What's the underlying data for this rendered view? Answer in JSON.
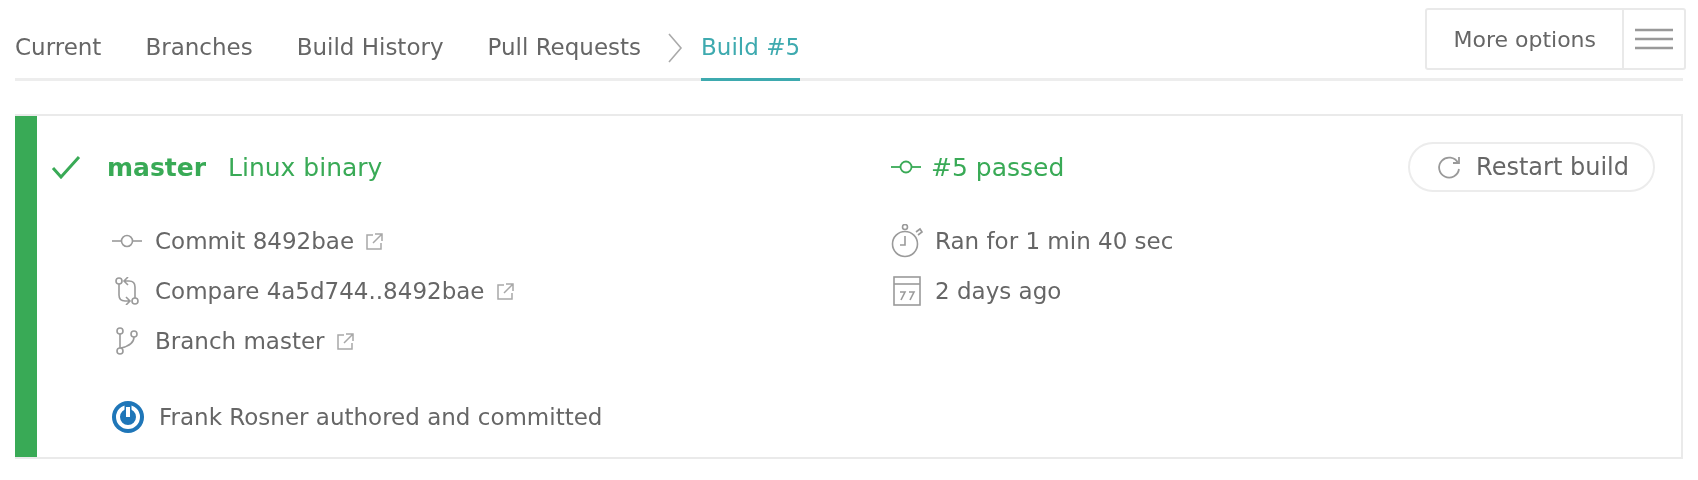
{
  "tabs": [
    {
      "label": "Current",
      "selected": false
    },
    {
      "label": "Branches",
      "selected": false
    },
    {
      "label": "Build History",
      "selected": false
    },
    {
      "label": "Pull Requests",
      "selected": false
    },
    {
      "label": "Build #5",
      "selected": true
    }
  ],
  "more_options": {
    "label": "More options"
  },
  "build": {
    "branch": "master",
    "job": "Linux binary",
    "status": "#5 passed",
    "restart": "Restart build",
    "details": [
      {
        "kind": "commit",
        "text": "Commit 8492bae"
      },
      {
        "kind": "compare",
        "text": "Compare 4a5d744..8492bae"
      },
      {
        "kind": "branch",
        "text": "Branch master"
      }
    ],
    "timing": [
      {
        "kind": "duration",
        "text": "Ran for 1 min 40 sec"
      },
      {
        "kind": "date",
        "text": "2 days ago"
      }
    ],
    "author": "Frank Rosner authored and committed"
  }
}
